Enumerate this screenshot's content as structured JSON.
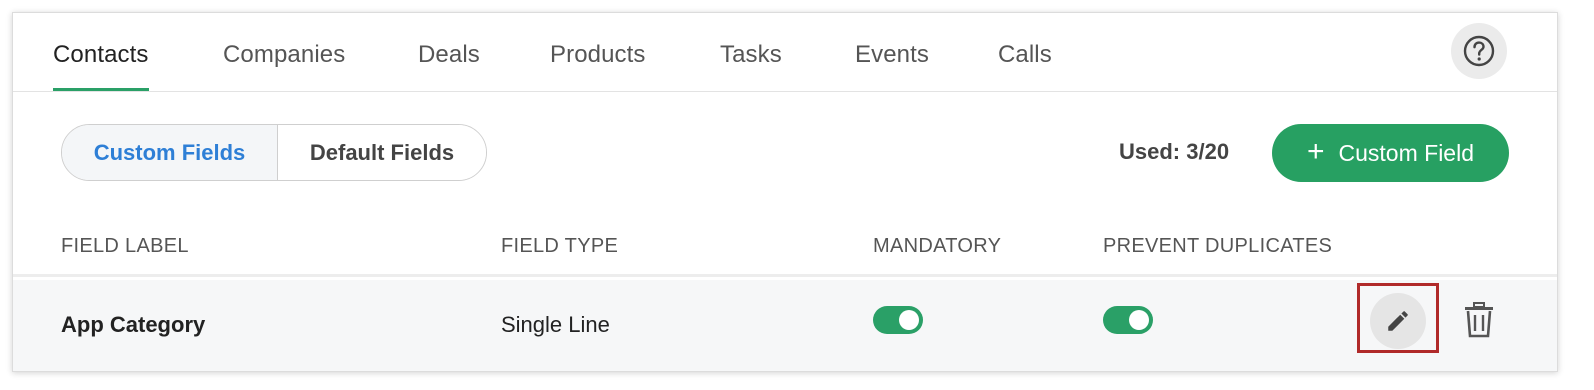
{
  "tabs": [
    {
      "label": "Contacts",
      "active": true
    },
    {
      "label": "Companies",
      "active": false
    },
    {
      "label": "Deals",
      "active": false
    },
    {
      "label": "Products",
      "active": false
    },
    {
      "label": "Tasks",
      "active": false
    },
    {
      "label": "Events",
      "active": false
    },
    {
      "label": "Calls",
      "active": false
    }
  ],
  "help": {
    "icon": "help-circle-icon"
  },
  "segment": {
    "custom_label": "Custom Fields",
    "default_label": "Default Fields",
    "selected": "Custom Fields"
  },
  "usage": {
    "text": "Used: 3/20"
  },
  "add_button": {
    "plus": "+",
    "label": "Custom Field"
  },
  "table": {
    "headers": [
      "FIELD LABEL",
      "FIELD TYPE",
      "MANDATORY",
      "PREVENT DUPLICATES"
    ],
    "rows": [
      {
        "field_label": "App Category",
        "field_type": "Single Line",
        "mandatory": true,
        "prevent_duplicates": true,
        "actions": [
          "edit-icon",
          "trash-icon"
        ]
      }
    ]
  },
  "colors": {
    "accent_green": "#27a062",
    "active_tab_underline": "#2aa067",
    "active_segment_text": "#2e7fd6",
    "highlight_border": "#b02a2a"
  }
}
